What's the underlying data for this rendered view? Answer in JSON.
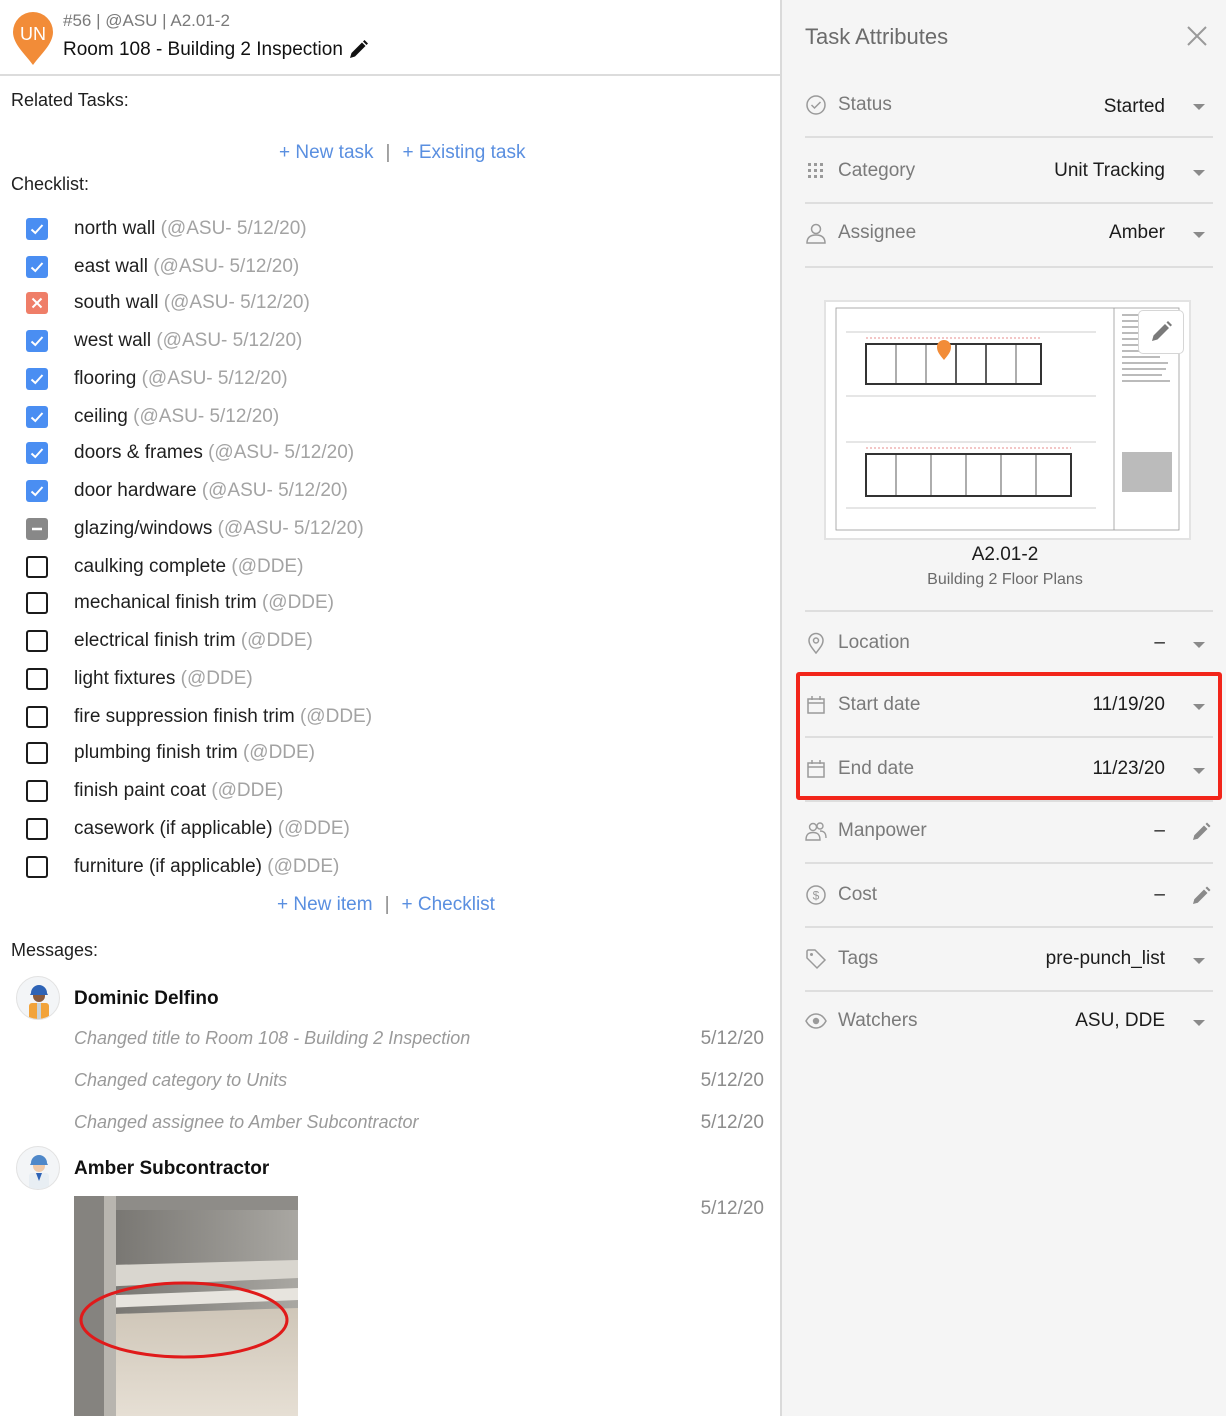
{
  "task": {
    "meta": "#56 | @ASU | A2.01-2",
    "title": "Room 108 - Building 2 Inspection",
    "pin_initials": "UN"
  },
  "related_tasks": {
    "label": "Related Tasks:",
    "new_task": "+ New task",
    "existing_task": "+ Existing task",
    "separator": "|"
  },
  "checklist": {
    "label": "Checklist:",
    "items": [
      {
        "text": "north wall",
        "meta": "(@ASU- 5/12/20)",
        "state": "checked"
      },
      {
        "text": "east wall",
        "meta": "(@ASU- 5/12/20)",
        "state": "checked"
      },
      {
        "text": "south wall",
        "meta": "(@ASU- 5/12/20)",
        "state": "failed"
      },
      {
        "text": "west wall",
        "meta": "(@ASU- 5/12/20)",
        "state": "checked"
      },
      {
        "text": "flooring",
        "meta": "(@ASU- 5/12/20)",
        "state": "checked"
      },
      {
        "text": "ceiling",
        "meta": "(@ASU- 5/12/20)",
        "state": "checked"
      },
      {
        "text": "doors & frames",
        "meta": "(@ASU- 5/12/20)",
        "state": "checked"
      },
      {
        "text": "door hardware",
        "meta": "(@ASU- 5/12/20)",
        "state": "checked"
      },
      {
        "text": "glazing/windows",
        "meta": "(@ASU- 5/12/20)",
        "state": "na"
      },
      {
        "text": "caulking complete",
        "meta": "(@DDE)",
        "state": "empty"
      },
      {
        "text": "mechanical finish trim",
        "meta": "(@DDE)",
        "state": "empty"
      },
      {
        "text": "electrical finish trim",
        "meta": "(@DDE)",
        "state": "empty"
      },
      {
        "text": "light fixtures",
        "meta": "(@DDE)",
        "state": "empty"
      },
      {
        "text": "fire suppression finish trim",
        "meta": "(@DDE)",
        "state": "empty"
      },
      {
        "text": "plumbing finish trim",
        "meta": "(@DDE)",
        "state": "empty"
      },
      {
        "text": "finish paint coat",
        "meta": "(@DDE)",
        "state": "empty"
      },
      {
        "text": "casework (if applicable)",
        "meta": "(@DDE)",
        "state": "empty"
      },
      {
        "text": "furniture (if applicable)",
        "meta": "(@DDE)",
        "state": "empty"
      }
    ],
    "new_item": "+ New item",
    "add_checklist": "+ Checklist",
    "separator": "|"
  },
  "messages": {
    "label": "Messages:",
    "threads": [
      {
        "author": "Dominic Delfino",
        "lines": [
          {
            "text": "Changed title to Room 108 - Building 2 Inspection",
            "date": "5/12/20"
          },
          {
            "text": "Changed category to Units",
            "date": "5/12/20"
          },
          {
            "text": "Changed assignee to Amber Subcontractor",
            "date": "5/12/20"
          }
        ]
      },
      {
        "author": "Amber Subcontractor",
        "photo_date": "5/12/20"
      }
    ]
  },
  "attributes": {
    "title": "Task Attributes",
    "status": {
      "label": "Status",
      "value": "Started"
    },
    "category": {
      "label": "Category",
      "value": "Unit Tracking"
    },
    "assignee": {
      "label": "Assignee",
      "value": "Amber"
    },
    "sheet": {
      "name": "A2.01-2",
      "subtitle": "Building 2 Floor Plans"
    },
    "location": {
      "label": "Location",
      "value": "–"
    },
    "start_date": {
      "label": "Start date",
      "value": "11/19/20"
    },
    "end_date": {
      "label": "End date",
      "value": "11/23/20"
    },
    "manpower": {
      "label": "Manpower",
      "value": "–"
    },
    "cost": {
      "label": "Cost",
      "value": "–"
    },
    "tags": {
      "label": "Tags",
      "value": "pre-punch_list"
    },
    "watchers": {
      "label": "Watchers",
      "value": "ASU, DDE"
    }
  },
  "colors": {
    "link": "#5a8fe0",
    "checked": "#4a8ef2",
    "failed": "#ef7e68",
    "na": "#888888",
    "pin": "#f28c38",
    "highlight": "#f2251a"
  }
}
